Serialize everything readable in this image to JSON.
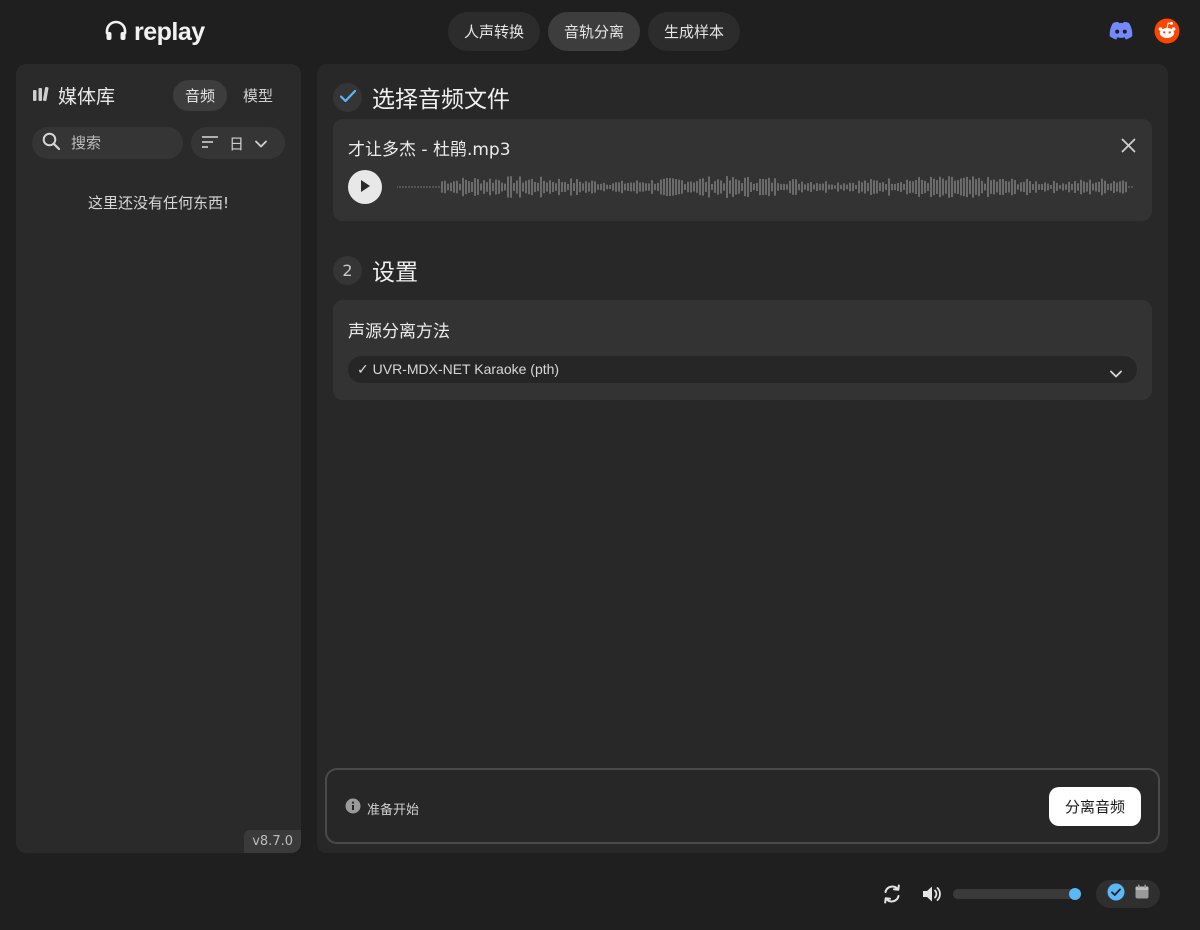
{
  "app": {
    "logo_text": "replay"
  },
  "nav": {
    "tabs": [
      {
        "label": "人声转换",
        "active": false
      },
      {
        "label": "音轨分离",
        "active": true
      },
      {
        "label": "生成样本",
        "active": false
      }
    ]
  },
  "header_icons": [
    "discord-icon",
    "reddit-icon"
  ],
  "sidebar": {
    "title": "媒体库",
    "tabs": [
      {
        "label": "音频",
        "active": true
      },
      {
        "label": "模型",
        "active": false
      }
    ],
    "search_placeholder": "搜索",
    "sort_label": "日",
    "empty_message": "这里还没有任何东西!",
    "version": "v8.7.0"
  },
  "main": {
    "step1": {
      "title": "选择音频文件",
      "file_name": "才让多杰 - 杜鹃.mp3"
    },
    "step2": {
      "number": "2",
      "title": "设置",
      "method_label": "声源分离方法",
      "method_value": "✓ UVR-MDX-NET Karaoke (pth)"
    },
    "status_text": "准备开始",
    "action_button": "分离音频"
  },
  "player": {
    "volume_level": 0.95
  },
  "colors": {
    "accent": "#59b8f5",
    "background": "#1f1f1f",
    "panel": "#282828"
  }
}
